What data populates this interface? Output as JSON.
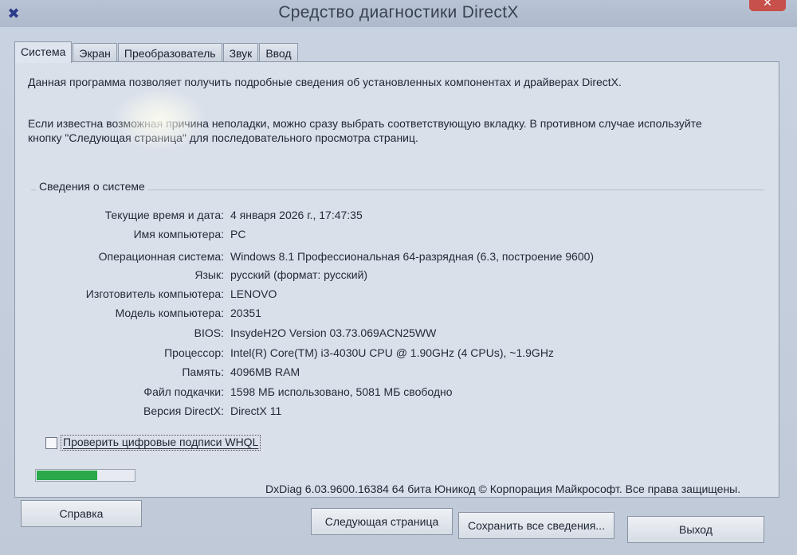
{
  "window": {
    "title": "Средство диагностики DirectX",
    "app_icon": "directx-icon",
    "close_glyph": "✕"
  },
  "tabs": [
    {
      "label": "Система",
      "active": true
    },
    {
      "label": "Экран",
      "active": false
    },
    {
      "label": "Преобразователь",
      "active": false
    },
    {
      "label": "Звук",
      "active": false
    },
    {
      "label": "Ввод",
      "active": false
    }
  ],
  "intro": {
    "line1": "Данная программа позволяет получить подробные сведения об установленных компонентах и драйверах DirectX.",
    "line2": "Если известна возможная причина неполадки, можно сразу выбрать соответствующую вкладку. В противном случае используйте",
    "line3": "кнопку \"Следующая страница\" для последовательного просмотра страниц."
  },
  "system_info": {
    "group_label": "Сведения о системе",
    "rows": [
      {
        "label": "Текущие время и дата:",
        "value": "4 января 2026 г., 17:47:35"
      },
      {
        "label": "Имя компьютера:",
        "value": "PC"
      },
      {
        "label": "Операционная система:",
        "value": "Windows 8.1 Профессиональная 64-разрядная (6.3, построение 9600)"
      },
      {
        "label": "Язык:",
        "value": "русский (формат: русский)"
      },
      {
        "label": "Изготовитель компьютера:",
        "value": "LENOVO"
      },
      {
        "label": "Модель компьютера:",
        "value": "20351"
      },
      {
        "label": "BIOS:",
        "value": "InsydeH2O Version 03.73.069ACN25WW"
      },
      {
        "label": "Процессор:",
        "value": "Intel(R) Core(TM) i3-4030U CPU @ 1.90GHz (4 CPUs), ~1.9GHz"
      },
      {
        "label": "Память:",
        "value": "4096MB RAM"
      },
      {
        "label": "Файл подкачки:",
        "value": "1598 МБ использовано, 5081 МБ свободно"
      },
      {
        "label": "Версия DirectX:",
        "value": "DirectX 11"
      }
    ]
  },
  "whql_checkbox": {
    "label": "Проверить цифровые подписи WHQL",
    "checked": false
  },
  "progress": {
    "fraction": 0.62,
    "color": "#2aa84a"
  },
  "copyright": "DxDiag 6.03.9600.16384 64 бита Юникод © Корпорация Майкрософт. Все права защищены.",
  "buttons": {
    "help": "Справка",
    "next_page": "Следующая страница",
    "save_all": "Сохранить все сведения...",
    "exit": "Выход"
  }
}
